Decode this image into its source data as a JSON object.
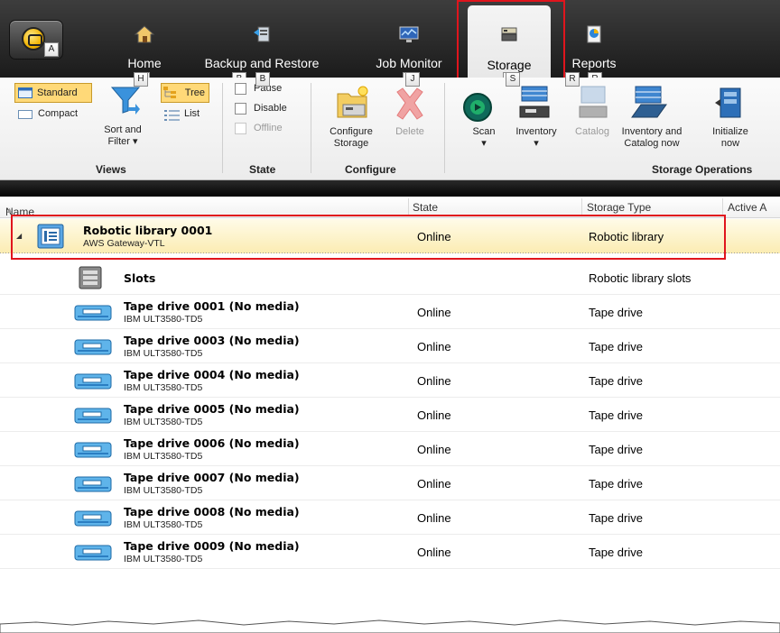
{
  "app_menu": {
    "keytip": "A"
  },
  "tabs": [
    {
      "label": "Home",
      "keytip": "H",
      "active": false,
      "icon": "home-icon"
    },
    {
      "label": "Backup and Restore",
      "keytip": "B",
      "active": false,
      "icon": "backup-icon"
    },
    {
      "label": "Job Monitor",
      "keytip": "J",
      "active": false,
      "icon": "monitor-icon"
    },
    {
      "label": "Storage",
      "keytip": "S",
      "active": true,
      "icon": "storage-icon"
    },
    {
      "label": "Reports",
      "keytip": "R",
      "active": false,
      "icon": "reports-icon"
    }
  ],
  "ribbon": {
    "views": {
      "group_label": "Views",
      "standard": "Standard",
      "compact": "Compact",
      "sort_filter_line1": "Sort and",
      "sort_filter_line2": "Filter",
      "tree": "Tree",
      "list": "List"
    },
    "state": {
      "group_label": "State",
      "pause": "Pause",
      "disable": "Disable",
      "offline": "Offline"
    },
    "configure": {
      "group_label": "Configure",
      "configure_storage_line1": "Configure",
      "configure_storage_line2": "Storage",
      "delete": "Delete"
    },
    "storage_ops": {
      "group_label": "Storage Operations",
      "scan": "Scan",
      "inventory": "Inventory",
      "catalog": "Catalog",
      "inventory_catalog_line1": "Inventory and",
      "inventory_catalog_line2": "Catalog now",
      "initialize_line1": "Initialize",
      "initialize_line2": "now"
    }
  },
  "grid": {
    "columns": [
      "Name",
      "State",
      "Storage Type",
      "Active A"
    ],
    "rows": [
      {
        "name": "Robotic library 0001",
        "sub": "AWS Gateway-VTL",
        "state": "Online",
        "type": "Robotic library",
        "kind": "library",
        "selected": true
      },
      {
        "name": "Slots",
        "sub": "",
        "state": "",
        "type": "Robotic library slots",
        "kind": "slots",
        "selected": false
      },
      {
        "name": "Tape drive 0001 (No media)",
        "sub": "IBM ULT3580-TD5",
        "state": "Online",
        "type": "Tape drive",
        "kind": "tape",
        "selected": false
      },
      {
        "name": "Tape drive 0003 (No media)",
        "sub": "IBM ULT3580-TD5",
        "state": "Online",
        "type": "Tape drive",
        "kind": "tape",
        "selected": false
      },
      {
        "name": "Tape drive 0004 (No media)",
        "sub": "IBM ULT3580-TD5",
        "state": "Online",
        "type": "Tape drive",
        "kind": "tape",
        "selected": false
      },
      {
        "name": "Tape drive 0005 (No media)",
        "sub": "IBM ULT3580-TD5",
        "state": "Online",
        "type": "Tape drive",
        "kind": "tape",
        "selected": false
      },
      {
        "name": "Tape drive 0006 (No media)",
        "sub": "IBM ULT3580-TD5",
        "state": "Online",
        "type": "Tape drive",
        "kind": "tape",
        "selected": false
      },
      {
        "name": "Tape drive 0007 (No media)",
        "sub": "IBM ULT3580-TD5",
        "state": "Online",
        "type": "Tape drive",
        "kind": "tape",
        "selected": false
      },
      {
        "name": "Tape drive 0008 (No media)",
        "sub": "IBM ULT3580-TD5",
        "state": "Online",
        "type": "Tape drive",
        "kind": "tape",
        "selected": false
      },
      {
        "name": "Tape drive 0009 (No media)",
        "sub": "IBM ULT3580-TD5",
        "state": "Online",
        "type": "Tape drive",
        "kind": "tape",
        "selected": false
      }
    ]
  },
  "colors": {
    "highlight": "#e0151d",
    "selected_row": "#fbecb2",
    "tab_strip": "#1b1b1b"
  }
}
